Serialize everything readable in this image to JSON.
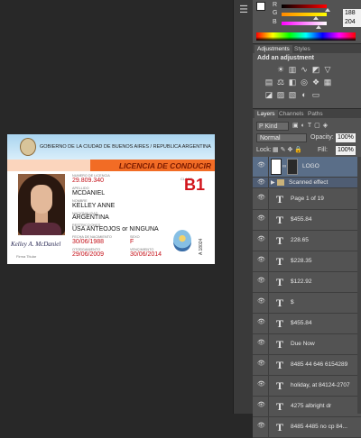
{
  "color_panel": {
    "sliders": [
      {
        "label": "R",
        "value": "",
        "color_from": "#000000",
        "color_to": "#ff0000"
      },
      {
        "label": "G",
        "value": "188",
        "color_from": "#ff0000",
        "color_to": "#ffff00"
      },
      {
        "label": "B",
        "value": "204",
        "color_from": "#0000ff",
        "color_to": "#ff00ff"
      }
    ]
  },
  "adjustments": {
    "tabs": [
      "Adjustments",
      "Styles"
    ],
    "title": "Add an adjustment"
  },
  "layers_panel": {
    "tabs": [
      "Layers",
      "Channels",
      "Paths"
    ],
    "kind_label": "P Kind",
    "blend_mode": "Normal",
    "opacity_label": "Opacity:",
    "opacity_value": "100%",
    "lock_label": "Lock:",
    "fill_label": "Fill:",
    "fill_value": "100%",
    "layers": [
      {
        "name": "LOGO",
        "kind": "image",
        "selected": true
      },
      {
        "name": "Scanned effect",
        "kind": "group"
      },
      {
        "name": "Page 1 of 19",
        "kind": "type"
      },
      {
        "name": "$455.84",
        "kind": "type"
      },
      {
        "name": "228.65",
        "kind": "type"
      },
      {
        "name": "$228.35",
        "kind": "type"
      },
      {
        "name": "$122.92",
        "kind": "type"
      },
      {
        "name": "$",
        "kind": "type"
      },
      {
        "name": "$455.84",
        "kind": "type"
      },
      {
        "name": "Due Now",
        "kind": "type"
      },
      {
        "name": "8485 44 646 6154289",
        "kind": "type"
      },
      {
        "name": "holiday, at 84124-2707",
        "kind": "type"
      },
      {
        "name": "4275 albright dr",
        "kind": "type"
      },
      {
        "name": "8485 4485 no cp 84...",
        "kind": "type"
      }
    ]
  },
  "license": {
    "header": "GOBIERNO DE LA CIUDAD DE BUENOS AIRES / REPUBLICA ARGENTINA",
    "title": "LICENCIA DE CONDUCIR",
    "license_no_label": "NUMERO DE LICENCIA",
    "license_no": "29.809.340",
    "surname_label": "APELLIDO",
    "surname": "MCDANIEL",
    "name_label": "NOMBRE",
    "name": "KELLEY ANNE",
    "nationality_label": "NACIONALIDAD",
    "nationality": "ARGENTINA",
    "restrictions_label": "RESTRICCIONES",
    "restrictions": "USA ANTEOJOS or NINGUNA",
    "birth_label": "FECHA DE NACIMIENTO",
    "birth": "30/06/1988",
    "sex_label": "SEXO",
    "sex": "F",
    "issued_label": "OTORGAMIENTO",
    "issued": "29/06/2009",
    "expiry_label": "VENCIMIENTO",
    "expiry": "30/06/2014",
    "class_label": "CLASE",
    "class": "B1",
    "signature": "Kelley A. McDaniel",
    "signature_label": "Firma Titular",
    "serial": "A 18024"
  }
}
